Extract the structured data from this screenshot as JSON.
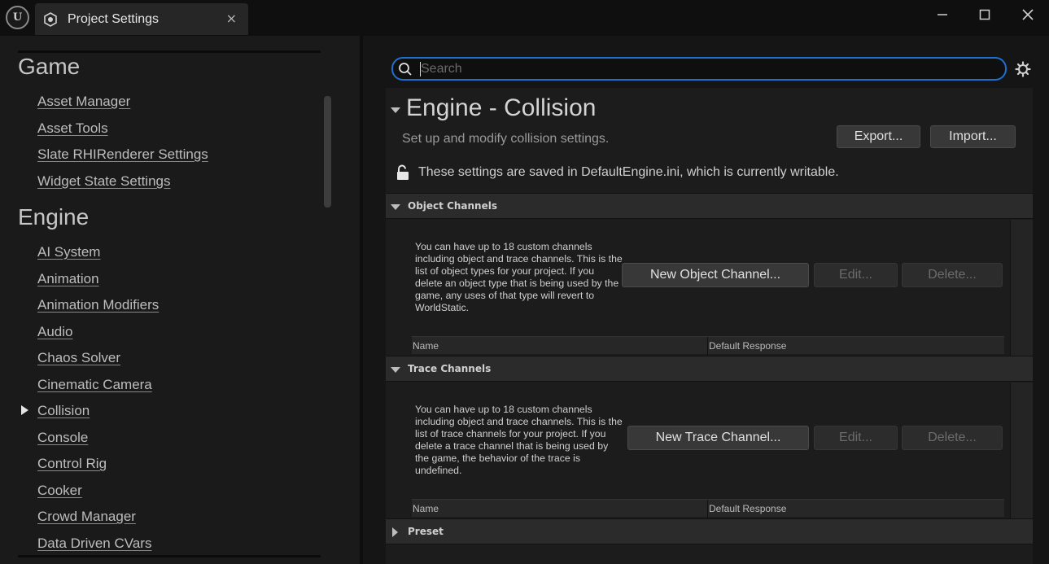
{
  "window": {
    "tab_title": "Project Settings",
    "tab_close": "×"
  },
  "sidebar": {
    "categories": [
      {
        "heading": "Game",
        "items": [
          "Asset Manager",
          "Asset Tools",
          "Slate RHIRenderer Settings",
          "Widget State Settings"
        ]
      },
      {
        "heading": "Engine",
        "items": [
          "AI System",
          "Animation",
          "Animation Modifiers",
          "Audio",
          "Chaos Solver",
          "Cinematic Camera",
          "Collision",
          "Console",
          "Control Rig",
          "Cooker",
          "Crowd Manager",
          "Data Driven CVars"
        ]
      }
    ],
    "selected_item": "Collision"
  },
  "search": {
    "placeholder": "Search",
    "value": ""
  },
  "section": {
    "title": "Engine - Collision",
    "description": "Set up and modify collision settings.",
    "export_label": "Export...",
    "import_label": "Import...",
    "writable_text": "These settings are saved in DefaultEngine.ini, which is currently writable."
  },
  "object_channels": {
    "label": "Object Channels",
    "help": "You can have up to 18 custom channels including object and trace channels. This is the list of object types for your project. If you delete an object type that is being used by the game, any uses of that type will revert to WorldStatic.",
    "new_label": "New Object Channel...",
    "edit_label": "Edit...",
    "delete_label": "Delete...",
    "col_name": "Name",
    "col_response": "Default Response"
  },
  "trace_channels": {
    "label": "Trace Channels",
    "help": "You can have up to 18 custom channels including object and trace channels. This is the list of trace channels for your project. If you delete a trace channel that is being used by the game, the behavior of the trace is undefined.",
    "new_label": "New Trace Channel...",
    "edit_label": "Edit...",
    "delete_label": "Delete...",
    "col_name": "Name",
    "col_response": "Default Response"
  },
  "preset": {
    "label": "Preset"
  },
  "colors": {
    "accent": "#1f6fd1",
    "background": "#151515",
    "panel": "#1c1c1c"
  }
}
